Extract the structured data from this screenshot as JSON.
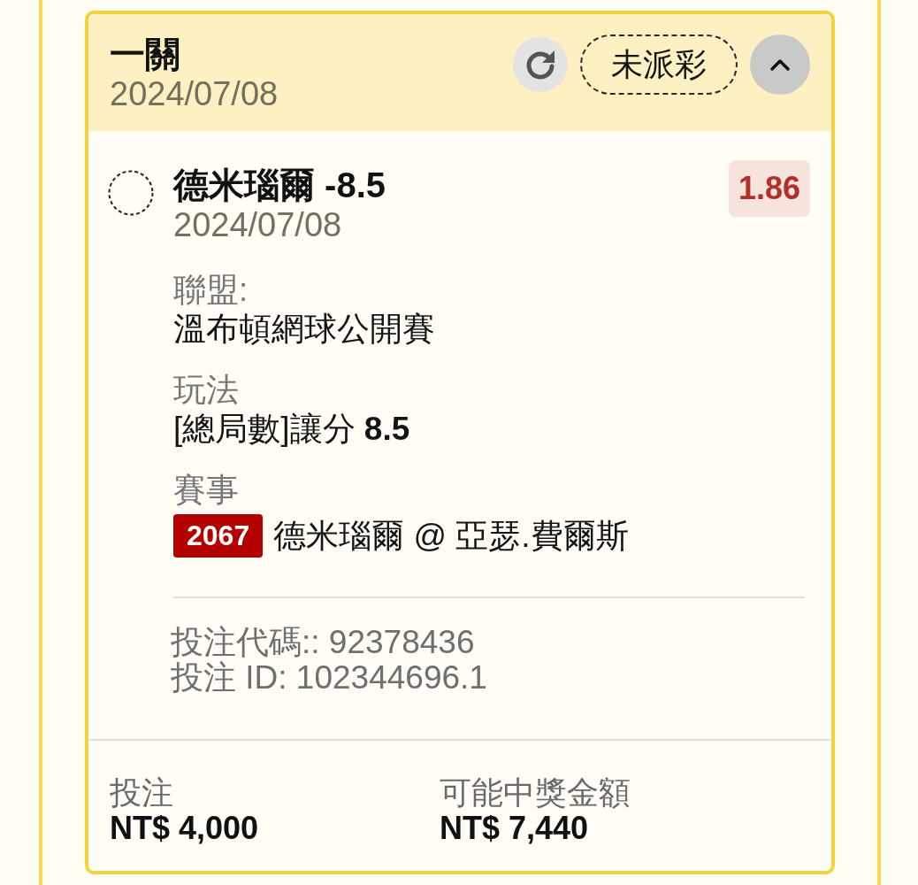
{
  "card": {
    "title": "一關",
    "date": "2024/07/08",
    "status": "未派彩",
    "expanded": true,
    "selection": {
      "name": "德米瑙爾 -8.5",
      "date": "2024/07/08",
      "odds": "1.86",
      "settled": false
    },
    "details": [
      {
        "kind": "plain",
        "label": "聯盟:",
        "value": "溫布頓網球公開賽"
      },
      {
        "kind": "plain",
        "label": "玩法",
        "value": "[總局數]讓分 **8.5**"
      },
      {
        "kind": "event",
        "label": "賽事",
        "event_number": "2067",
        "value": "德米瑙爾 @ 亞瑟.費爾斯"
      }
    ],
    "references": [
      "投注代碼:: 92378436",
      "投注 ID: 102344696.1"
    ],
    "summary": [
      {
        "label": "投注",
        "amount": "NT$ 4,000"
      },
      {
        "label": "可能中獎金額",
        "amount": "NT$ 7,440"
      }
    ]
  }
}
